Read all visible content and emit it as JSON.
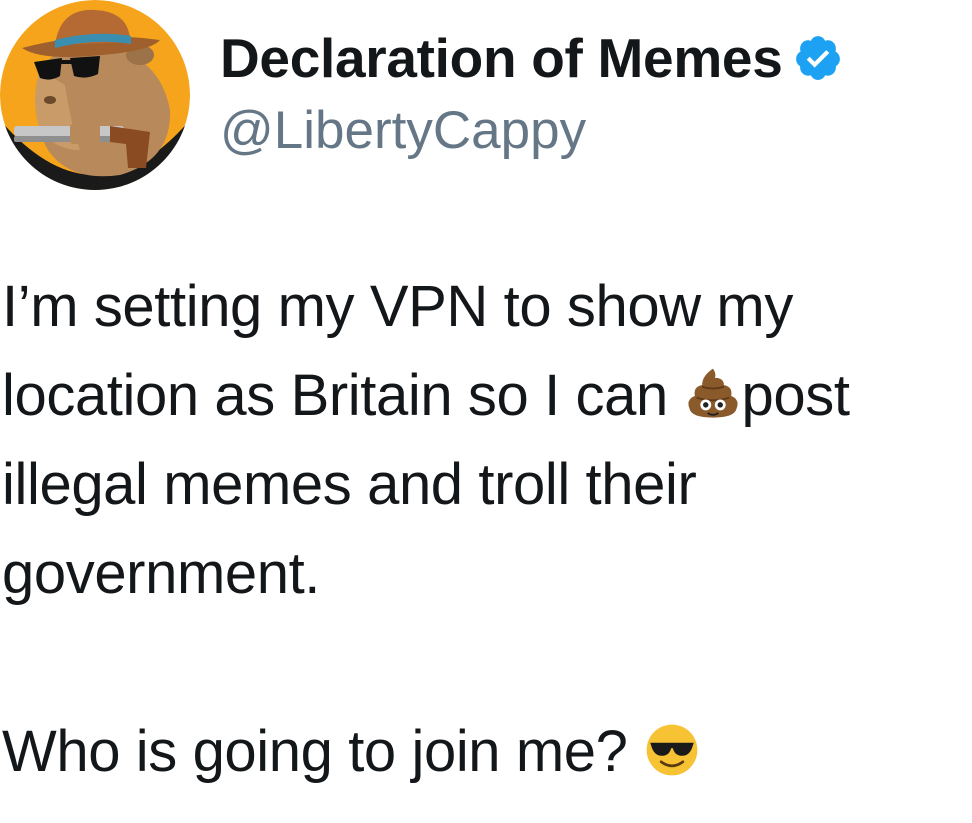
{
  "account": {
    "display_name": "Declaration of Memes",
    "handle": "@LibertyCappy",
    "verified_icon": "verified-badge-icon",
    "avatar_icon": "capybara-cowboy-avatar"
  },
  "tweet": {
    "line1": "I’m setting my VPN to show my",
    "line2_before": "location as Britain so I can",
    "line2_emoji": "pile-of-poo-icon",
    "line2_after": "post",
    "line3": "illegal memes and troll their",
    "line4": "government.",
    "line5": "Who is going to join me?",
    "line5_emoji": "smiling-face-with-sunglasses-icon"
  },
  "colors": {
    "verified_blue": "#1da1f2",
    "handle_gray": "#657786",
    "text": "#14171a"
  }
}
